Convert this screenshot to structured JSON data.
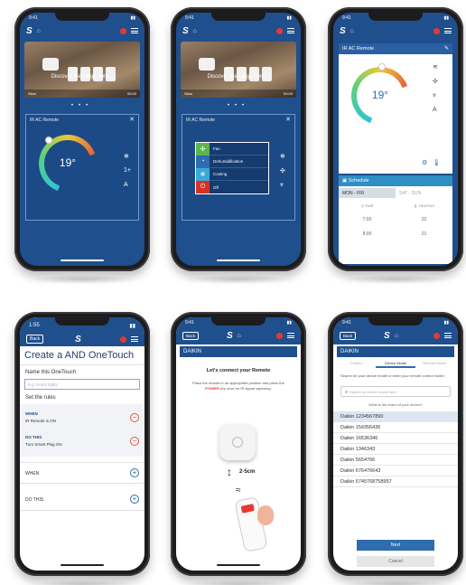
{
  "phones": {
    "p1": {
      "status_time": "9:41",
      "banner_text": "Discover the range here...",
      "banner_left": "Sitoo",
      "banner_right": "00:00",
      "card_title": "IR AC Remote",
      "temp": "19°"
    },
    "p2": {
      "status_time": "9:41",
      "banner_text": "Discover the range here...",
      "banner_left": "Sitoo",
      "banner_right": "00:00",
      "card_title": "IR AC Remote",
      "modes": [
        "Fan",
        "Dehumidification",
        "Cooling",
        "Off"
      ]
    },
    "p3": {
      "status_time": "9:41",
      "card_title": "IR AC Remote",
      "temp": "19°",
      "schedule_title": "Schedule",
      "tab1": "MON - FRI",
      "tab2": "SAT - SUN",
      "col1": "TIME",
      "col2": "HEATING",
      "rows": [
        [
          "7:00",
          "20"
        ],
        [
          "8:00",
          "21"
        ]
      ]
    },
    "p4": {
      "status_time": "1:55",
      "back_label": "Back",
      "title": "Create a AND OneTouch",
      "name_label": "Name this OneTouch",
      "name_placeholder": "E.g. Porch lights",
      "rules_label": "Set the rules",
      "when_label": "WHEN",
      "when_value": "IR Remote is ON",
      "dothis_label": "DO THIS",
      "dothis_value": "Turn Smart Plug ON",
      "add_when": "WHEN",
      "add_dothis": "DO THIS"
    },
    "p5": {
      "status_time": "9:41",
      "back_label": "Back",
      "brand": "DAIKIN",
      "heading": "Let's connect your Remote",
      "instruction_pre": "Place the remote in an appropriate position and press the ",
      "instruction_key": "POWER",
      "instruction_post": " key once for IR signal capturing.",
      "distance": "2-5cm"
    },
    "p6": {
      "status_time": "9:41",
      "back_label": "Back",
      "brand": "DAIKIN",
      "tabs": [
        "Custom",
        "Device Model",
        "Remote Model"
      ],
      "search_hint": "Search for your device model or enter your remote control model.",
      "search_placeholder": "Search by device model here",
      "brand_question": "What is the brand of your device?",
      "models": [
        "Daikin 1234567890",
        "Daikin 154356436",
        "Daikin 16536346",
        "Daikin 1346343",
        "Daikin 5654766",
        "Daikin 676476643",
        "Daikin 5745768758957"
      ],
      "next_label": "Next",
      "cancel_label": "Cancel"
    }
  },
  "colors": {
    "brand_blue": "#1f4f8c",
    "alert_red": "#e53935",
    "accent_teal": "#2ec4d6"
  }
}
